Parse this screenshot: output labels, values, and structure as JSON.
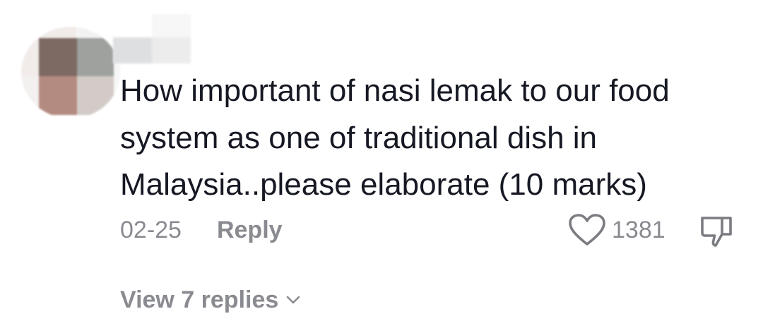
{
  "comment": {
    "text": "How important of nasi lemak to our food\nsystem as one of traditional dish in\nMalaysia..please elaborate (10 marks)",
    "date": "02-25",
    "reply_label": "Reply",
    "like_count": "1381",
    "view_replies_label": "View 7 replies"
  },
  "icons": {
    "like": "heart-outline-icon",
    "dislike": "thumbs-down-outline-icon",
    "expand": "chevron-down-icon"
  },
  "colors": {
    "text_primary": "#161823",
    "text_secondary": "#8a8b91",
    "background": "#ffffff"
  }
}
